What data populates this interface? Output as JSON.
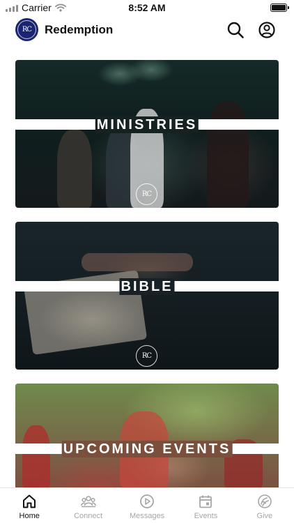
{
  "status_bar": {
    "carrier": "Carrier",
    "time": "8:52 AM"
  },
  "header": {
    "title": "Redemption",
    "logo_text": "RC"
  },
  "cards": [
    {
      "label": "MINISTRIES",
      "seal_text": "RC"
    },
    {
      "label": "BIBLE",
      "seal_text": "RC"
    },
    {
      "label": "UPCOMING EVENTS"
    }
  ],
  "tabs": [
    {
      "label": "Home",
      "icon": "home-icon",
      "active": true
    },
    {
      "label": "Connect",
      "icon": "group-icon"
    },
    {
      "label": "Messages",
      "icon": "play-icon"
    },
    {
      "label": "Events",
      "icon": "calendar-icon"
    },
    {
      "label": "Give",
      "icon": "give-icon"
    }
  ]
}
